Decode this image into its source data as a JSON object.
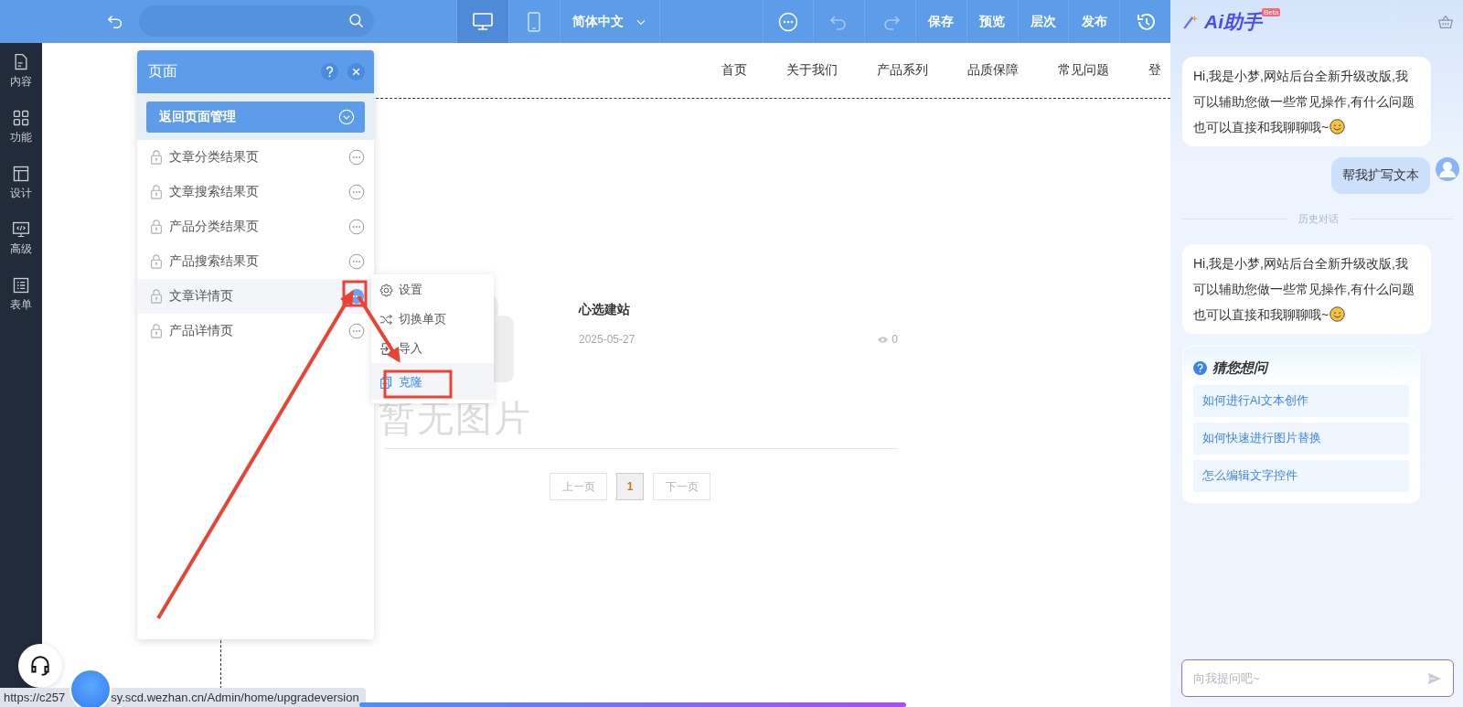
{
  "toolbar": {
    "device_tabs": [
      {
        "kind": "desktop",
        "selected": true
      },
      {
        "kind": "mobile",
        "selected": false
      }
    ],
    "language": "简体中文",
    "actions": [
      "保存",
      "预览",
      "层次",
      "发布"
    ]
  },
  "sidebar": {
    "items": [
      {
        "label": "内容",
        "kind": "content"
      },
      {
        "label": "功能",
        "kind": "features"
      },
      {
        "label": "设计",
        "kind": "design"
      },
      {
        "label": "高级",
        "kind": "advanced"
      },
      {
        "label": "表单",
        "kind": "form"
      }
    ]
  },
  "page_panel": {
    "title": "页面",
    "back_button": "返回页面管理",
    "pages": [
      {
        "label": "文章分类结果页",
        "selected": false
      },
      {
        "label": "文章搜索结果页",
        "selected": false
      },
      {
        "label": "产品分类结果页",
        "selected": false
      },
      {
        "label": "产品搜索结果页",
        "selected": false
      },
      {
        "label": "文章详情页",
        "selected": true
      },
      {
        "label": "产品详情页",
        "selected": false
      }
    ]
  },
  "context_menu": {
    "items": [
      {
        "label": "设置",
        "kind": "settings",
        "selected": false
      },
      {
        "label": "切换单页",
        "kind": "switch",
        "selected": false
      },
      {
        "label": "导入",
        "kind": "import",
        "selected": false
      },
      {
        "label": "克隆",
        "kind": "clone",
        "selected": true
      }
    ]
  },
  "site": {
    "nav": [
      "首页",
      "关于我们",
      "产品系列",
      "品质保障",
      "常见问题",
      "登"
    ],
    "article": {
      "image_placeholder": "暂无图片",
      "title": "心选建站",
      "date": "2025-05-27",
      "views": "0"
    },
    "pagination": {
      "prev": "上一页",
      "pages": [
        {
          "label": "1",
          "selected": true
        }
      ],
      "next": "下一页"
    }
  },
  "ai_assistant": {
    "title": "Ai助手",
    "badge": "Beta",
    "messages": [
      {
        "kind": "assistant",
        "text": "Hi,我是小梦,网站后台全新升级改版,我可以辅助您做一些常见操作,有什么问题也可以直接和我聊聊哦~"
      },
      {
        "kind": "user",
        "text": "帮我扩写文本"
      },
      {
        "kind": "divider",
        "text": "历史对话"
      },
      {
        "kind": "assistant",
        "text": "Hi,我是小梦,网站后台全新升级改版,我可以辅助您做一些常见操作,有什么问题也可以直接和我聊聊哦~"
      }
    ],
    "suggestions": {
      "title": "猜您想问",
      "items": [
        "如何进行AI文本创作",
        "如何快速进行图片替换",
        "怎么编辑文字控件"
      ]
    },
    "input": {
      "placeholder": "向我提问吧~"
    }
  },
  "status_bar": {
    "url_parts": [
      "https://c257",
      "sy.scd.wezhan.cn/Admin/home/upgradeversion"
    ]
  }
}
